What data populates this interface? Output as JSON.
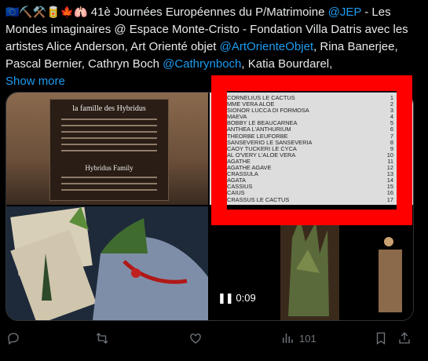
{
  "tweet": {
    "emojis": "🇪🇺⛏️⚒️🥫🍁🫁",
    "text_before_jep": " 41è Journées Européennes du P/Matrimoine ",
    "jep": "@JEP",
    "text_after_jep": " - Les Mondes imaginaires @ Espace Monte-Cristo - Fondation Villa Datris avec les artistes Alice Anderson, Art Orienté objet ",
    "mention_aoo": "@ArtOrienteObjet",
    "text_after_aoo": ", Rina Banerjee, Pascal Bernier, Cathryn Boch ",
    "mention_cb": "@Cathrynboch",
    "text_after_cb": ", Katia Bourdarel,",
    "show_more": "Show more"
  },
  "media": {
    "poster": {
      "title": "la famille des Hybridus",
      "subtitle": "Hybridus Family"
    },
    "list": [
      {
        "name": "CORNELIUS LE CACTUS",
        "n": "1"
      },
      {
        "name": "MME VERA ALOE",
        "n": "2"
      },
      {
        "name": "SIONOR LUCCA DI FORMOSA",
        "n": "3"
      },
      {
        "name": "MAEVA",
        "n": "4"
      },
      {
        "name": "BOBBY LE BEAUCARNEA",
        "n": "5"
      },
      {
        "name": "ANTHEA L'ANTHURIUM",
        "n": "6"
      },
      {
        "name": "THEORBE LEUFORBE",
        "n": "7"
      },
      {
        "name": "SANSEVERIO LE SANSEVERIA",
        "n": "8"
      },
      {
        "name": "CAOY TUCKERI LE CYCA",
        "n": "9"
      },
      {
        "name": "AL O'VERY L'ALOE VERA",
        "n": "10"
      },
      {
        "name": "AGATHE",
        "n": "11"
      },
      {
        "name": "AGATHE AGAVE",
        "n": "12"
      },
      {
        "name": "CRASSULA",
        "n": "13"
      },
      {
        "name": "AGATA",
        "n": "14"
      },
      {
        "name": "CASSIUS",
        "n": "15"
      },
      {
        "name": "CAIUS",
        "n": "16"
      },
      {
        "name": "CRASSUS LE CACTUS",
        "n": "17"
      }
    ],
    "video_time": "0:09"
  },
  "actions": {
    "views": "101"
  },
  "colors": {
    "link": "#1d9bf0",
    "highlight": "#ff0000",
    "muted": "#71767b"
  }
}
